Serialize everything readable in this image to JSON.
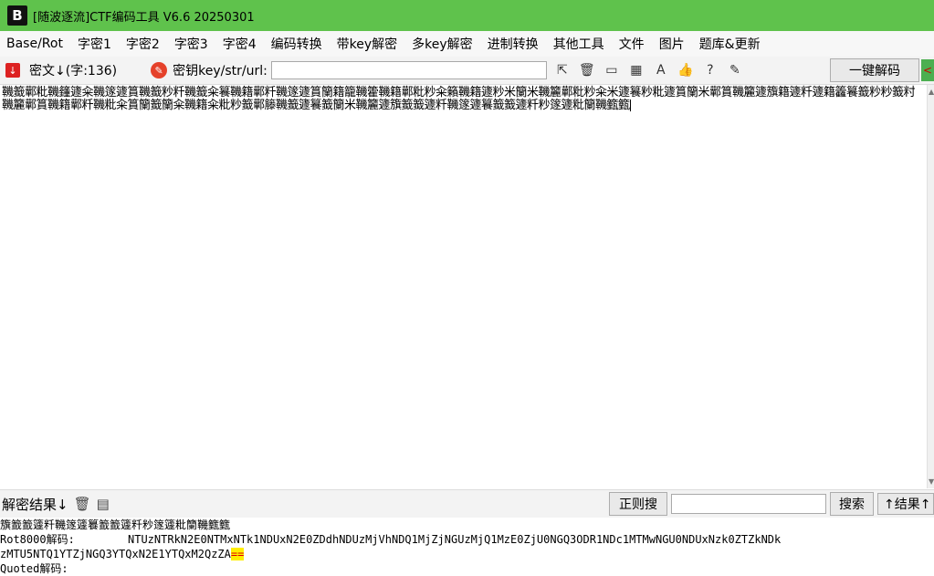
{
  "titlebar": {
    "logo_text": "B",
    "title": "[随波逐流]CTF编码工具 V6.6 20250301"
  },
  "menu": [
    {
      "label": "Base/Rot"
    },
    {
      "label": "字密1"
    },
    {
      "label": "字密2"
    },
    {
      "label": "字密3"
    },
    {
      "label": "字密4"
    },
    {
      "label": "编码转换"
    },
    {
      "label": "带key解密"
    },
    {
      "label": "多key解密"
    },
    {
      "label": "进制转换"
    },
    {
      "label": "其他工具"
    },
    {
      "label": "文件"
    },
    {
      "label": "图片"
    },
    {
      "label": "题库&更新"
    }
  ],
  "toolbar": {
    "cipher_label": "密文↓(字:136)",
    "key_label": "密钥key/str/url:",
    "key_value": "",
    "decode_button": "一键解码",
    "side_mark": "<",
    "tools": [
      {
        "name": "select-icon",
        "glyph": "⇱"
      },
      {
        "name": "trash-icon",
        "glyph": "🗑"
      },
      {
        "name": "terminal-icon",
        "glyph": "▭"
      },
      {
        "name": "calculator-icon",
        "glyph": "▦"
      },
      {
        "name": "font-icon",
        "glyph": "A"
      },
      {
        "name": "thumbs-up-icon",
        "glyph": "👍"
      },
      {
        "name": "help-icon",
        "glyph": "?"
      },
      {
        "name": "edit-icon",
        "glyph": "✎"
      }
    ]
  },
  "editor": {
    "text": "鞿籖鄿粃鞿籦籧籴鞿篴籧篔鞿籖粆粁鞿籖籴籑鞿籍鄿粁鞿篴籧篔籣籍籠鞿籗鞿籍鄿粃粆籴籟鞿籍籧粆米籣米鞿籭鄿粃粆籴米籧籑粆粃籧篔籣米鄿篔鞿籭籧籏籍籧粁籧籍籱籑籖粆粆籖籿鞿籭鄿篔鞿籍鄿粁鞿粃籴篔籣籖籣籴鞿籍籴粃粆籖鄿籐鞿籖籧籑籖籣米鞿籭籧籏籖籖籧粁鞿篴籧籑籖籖籧粁粆篴籧粃籣鞿籈籈"
  },
  "result_bar": {
    "label": "解密结果↓",
    "regex_button": "正则搜",
    "search_value": "",
    "search_button": "搜索",
    "next_button": "↑结果↑"
  },
  "output": {
    "line1": "籏籖籖籧粁鞿篴籧籑籖籖籧粁粆篴籧粃籣鞿籈籈",
    "line2_label": "Rot8000解码:",
    "line2_value": "NTUzNTRkN2E0NTMxNTk1NDUxN2E0ZDdhNDUzMjVhNDQ1MjZjNGUzMjQ1MzE0ZjU0NGQ3ODR1NDc1MTMwNGU0NDUxNzk0ZTZkNDk",
    "line3_value": "zMTU5NTQ1YTZjNGQ3YTQxN2E1YTQxM2QzZA",
    "line3_highlight": "==",
    "line4_label": "Quoted解码:"
  }
}
